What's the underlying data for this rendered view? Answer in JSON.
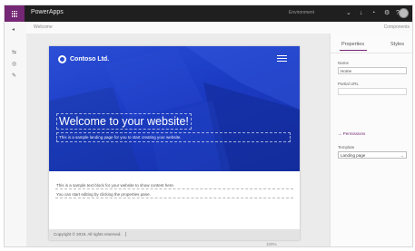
{
  "app": {
    "title": "PowerApps",
    "environment": "Environment"
  },
  "top_icons": [
    "chevron-down-icon",
    "download-icon",
    "notification-icon",
    "settings-icon",
    "help-icon"
  ],
  "command": {
    "left": "Welcome",
    "right": "Components"
  },
  "website": {
    "logo_text": "Contoso Ltd.",
    "headline": "Welcome to your website!",
    "subline": "This is a sample landing page for you to start creating your website.",
    "body_lines": [
      "This is a sample text block for your website to show content here.",
      "You can start editing by clicking the properties pane."
    ],
    "footer": "Copyright © 2019. All rights reserved."
  },
  "panel": {
    "tabs": [
      "Properties",
      "Styles"
    ],
    "name_label": "Name",
    "name_value": "Home",
    "partial_url_label": "Partial URL",
    "partial_url_value": "",
    "link_text": "Permissions",
    "template_label": "Template",
    "template_value": "Landing page"
  },
  "status": {
    "zoom": "100%"
  },
  "colors": {
    "accent": "#742774",
    "hero": "#1b3bc3",
    "topbar": "#1f1f1f"
  }
}
